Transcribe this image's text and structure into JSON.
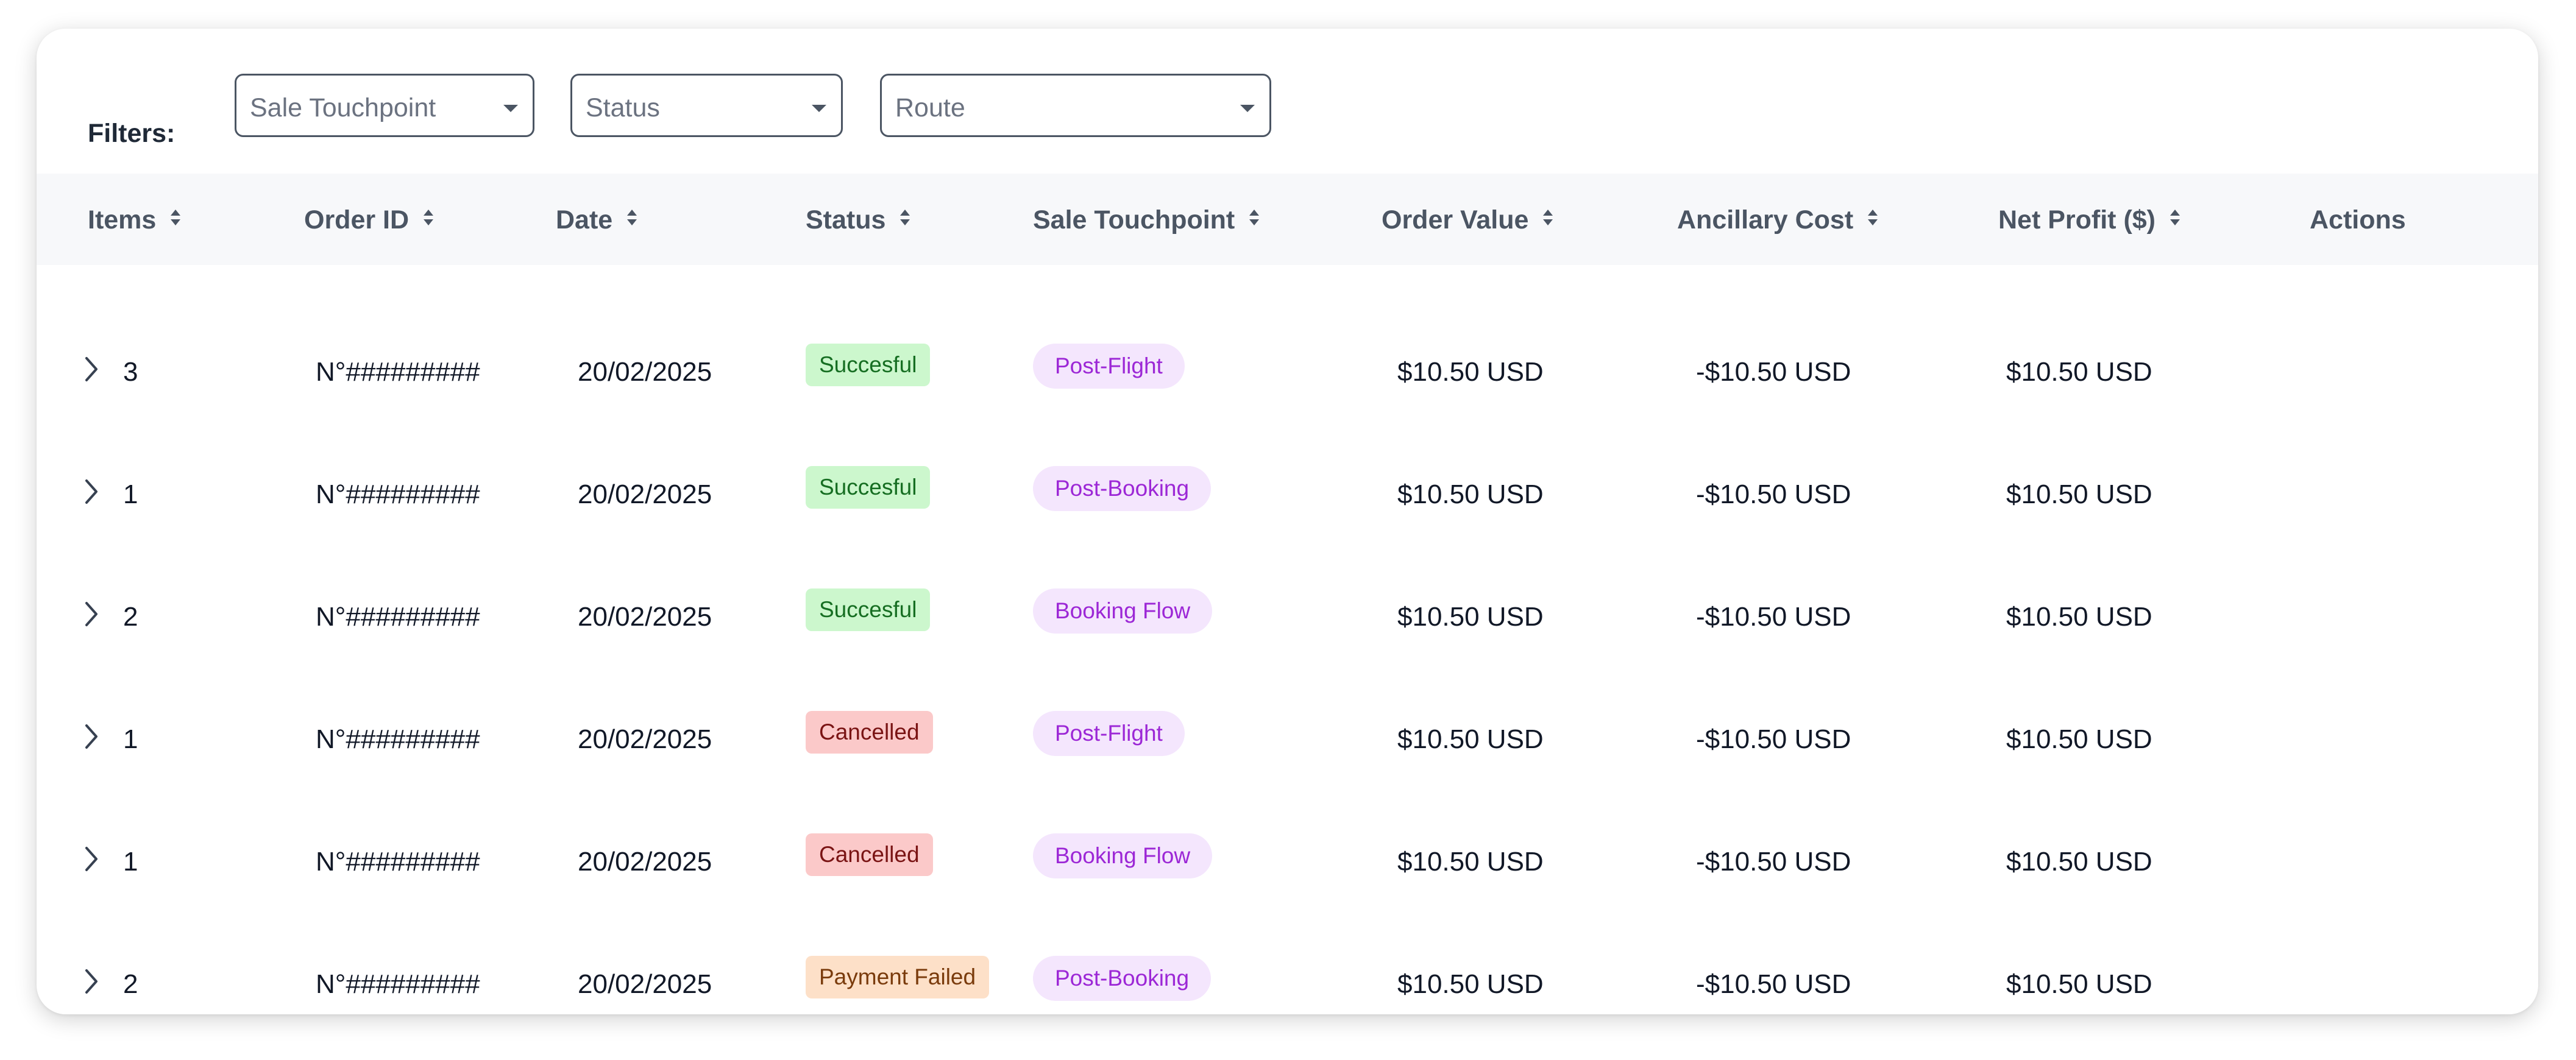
{
  "filters": {
    "label": "Filters:",
    "selects": [
      {
        "value": "Sale Touchpoint"
      },
      {
        "value": "Status"
      },
      {
        "value": "Route"
      }
    ]
  },
  "columns": [
    "Items",
    "Order ID",
    "Date",
    "Status",
    "Sale Touchpoint",
    "Order Value",
    "Ancillary Cost",
    "Net Profit ($)",
    "Actions"
  ],
  "status_colors": {
    "Succesful": {
      "bg": "#ccf7cd",
      "fg": "#166e22"
    },
    "Cancelled": {
      "bg": "#fbc9c9",
      "fg": "#7a1414"
    },
    "Payment Failed": {
      "bg": "#fde0c8",
      "fg": "#7a3b0c"
    }
  },
  "rows": [
    {
      "items": "3",
      "order_id": "N°#########",
      "date": "20/02/2025",
      "status": "Succesful",
      "touchpoint": "Post-Flight",
      "order_value": "$10.50 USD",
      "ancillary_cost": "-$10.50 USD",
      "net_profit": "$10.50 USD"
    },
    {
      "items": "1",
      "order_id": "N°#########",
      "date": "20/02/2025",
      "status": "Succesful",
      "touchpoint": "Post-Booking",
      "order_value": "$10.50 USD",
      "ancillary_cost": "-$10.50 USD",
      "net_profit": "$10.50 USD"
    },
    {
      "items": "2",
      "order_id": "N°#########",
      "date": "20/02/2025",
      "status": "Succesful",
      "touchpoint": "Booking Flow",
      "order_value": "$10.50 USD",
      "ancillary_cost": "-$10.50 USD",
      "net_profit": "$10.50 USD"
    },
    {
      "items": "1",
      "order_id": "N°#########",
      "date": "20/02/2025",
      "status": "Cancelled",
      "touchpoint": "Post-Flight",
      "order_value": "$10.50 USD",
      "ancillary_cost": "-$10.50 USD",
      "net_profit": "$10.50 USD"
    },
    {
      "items": "1",
      "order_id": "N°#########",
      "date": "20/02/2025",
      "status": "Cancelled",
      "touchpoint": "Booking Flow",
      "order_value": "$10.50 USD",
      "ancillary_cost": "-$10.50 USD",
      "net_profit": "$10.50 USD"
    },
    {
      "items": "2",
      "order_id": "N°#########",
      "date": "20/02/2025",
      "status": "Payment Failed",
      "touchpoint": "Post-Booking",
      "order_value": "$10.50 USD",
      "ancillary_cost": "-$10.50 USD",
      "net_profit": "$10.50 USD"
    }
  ]
}
